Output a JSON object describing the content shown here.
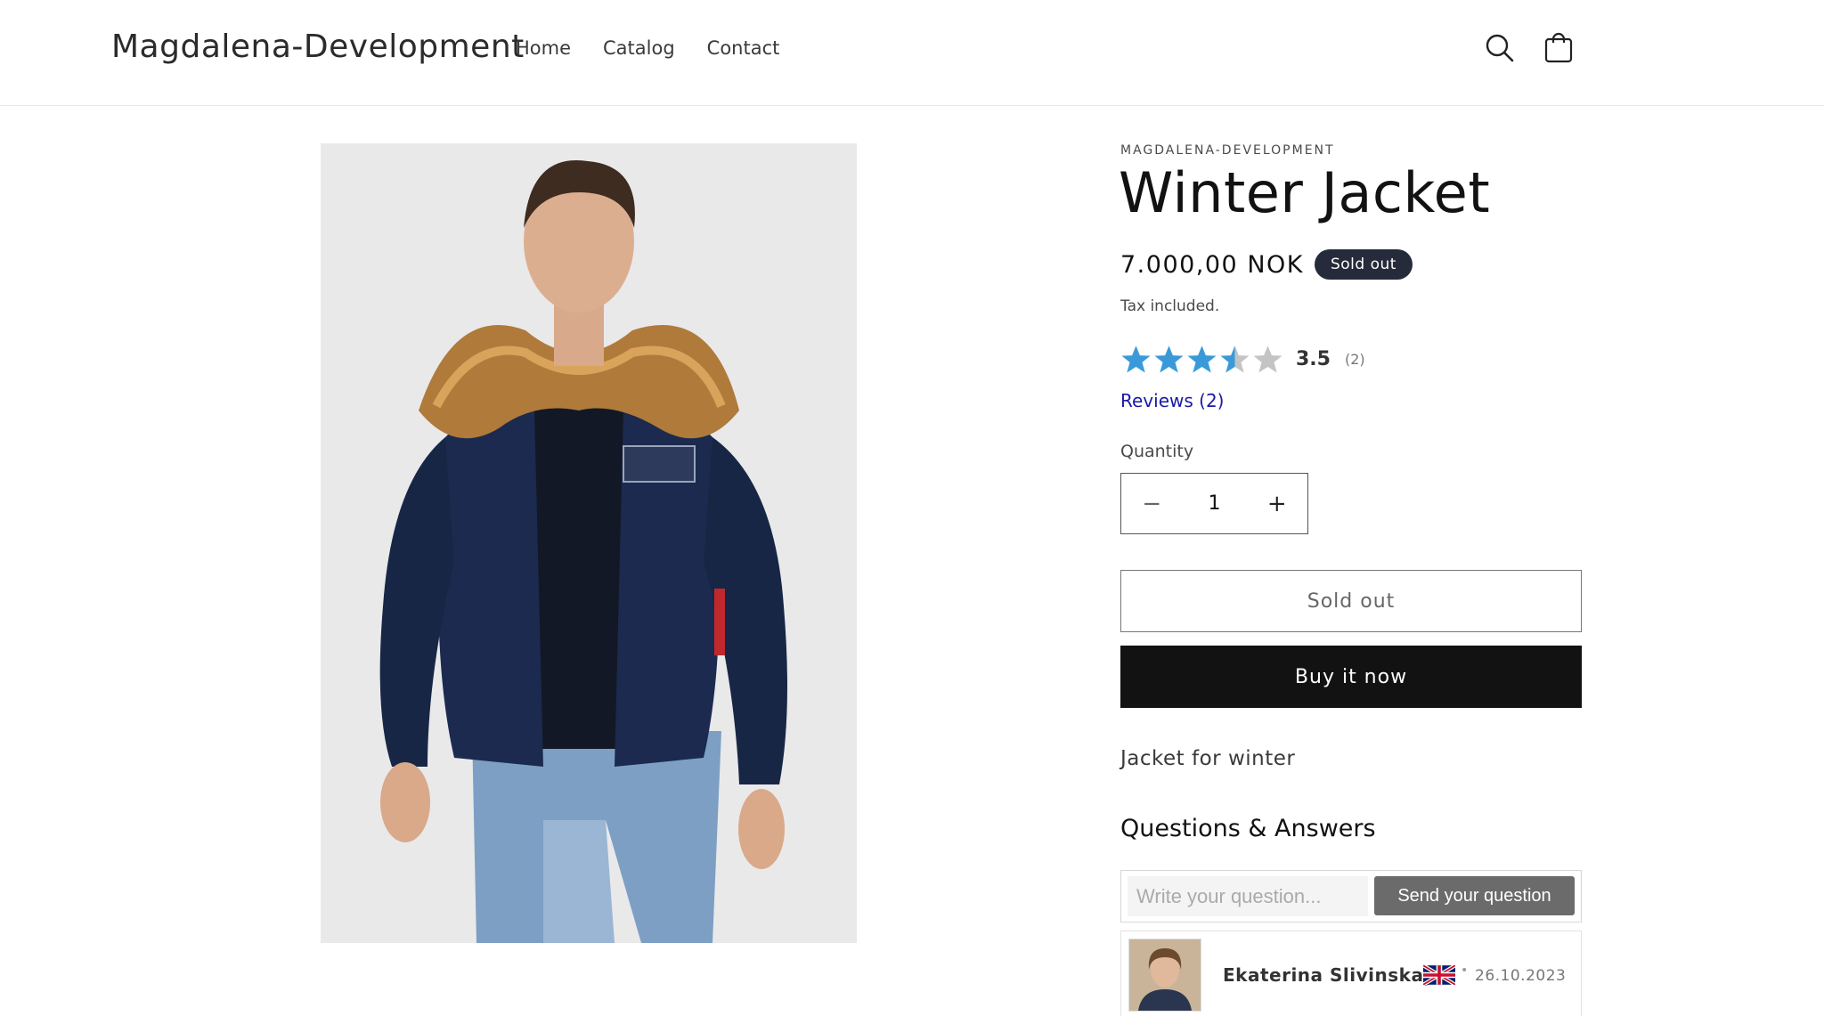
{
  "header": {
    "logo": "Magdalena-Development",
    "nav": [
      "Home",
      "Catalog",
      "Contact"
    ],
    "icons": [
      "search-icon",
      "cart-icon"
    ]
  },
  "product": {
    "vendor": "MAGDALENA-DEVELOPMENT",
    "title": "Winter Jacket",
    "price": "7.000,00 NOK",
    "badge": "Sold out",
    "tax_note": "Tax included.",
    "rating": {
      "value": "3.5",
      "count": "(2)",
      "stars": 3.5,
      "star_color": "#3a9ad9",
      "empty_color": "#c4c4c4"
    },
    "reviews_link": "Reviews (2)",
    "quantity_label": "Quantity",
    "quantity_value": "1",
    "soldout_button": "Sold out",
    "buy_button": "Buy it now",
    "description": "Jacket for winter"
  },
  "qa": {
    "title": "Questions & Answers",
    "placeholder": "Write your question...",
    "send_label": "Send your question",
    "items": [
      {
        "author": "Ekaterina Slivinskaya",
        "flag": "uk-flag-icon",
        "date": "26.10.2023"
      }
    ]
  },
  "colors": {
    "badge_bg": "#252b3a",
    "buy_bg": "#121212",
    "link": "#1a1aa6",
    "send_bg": "#6b6b6b"
  }
}
